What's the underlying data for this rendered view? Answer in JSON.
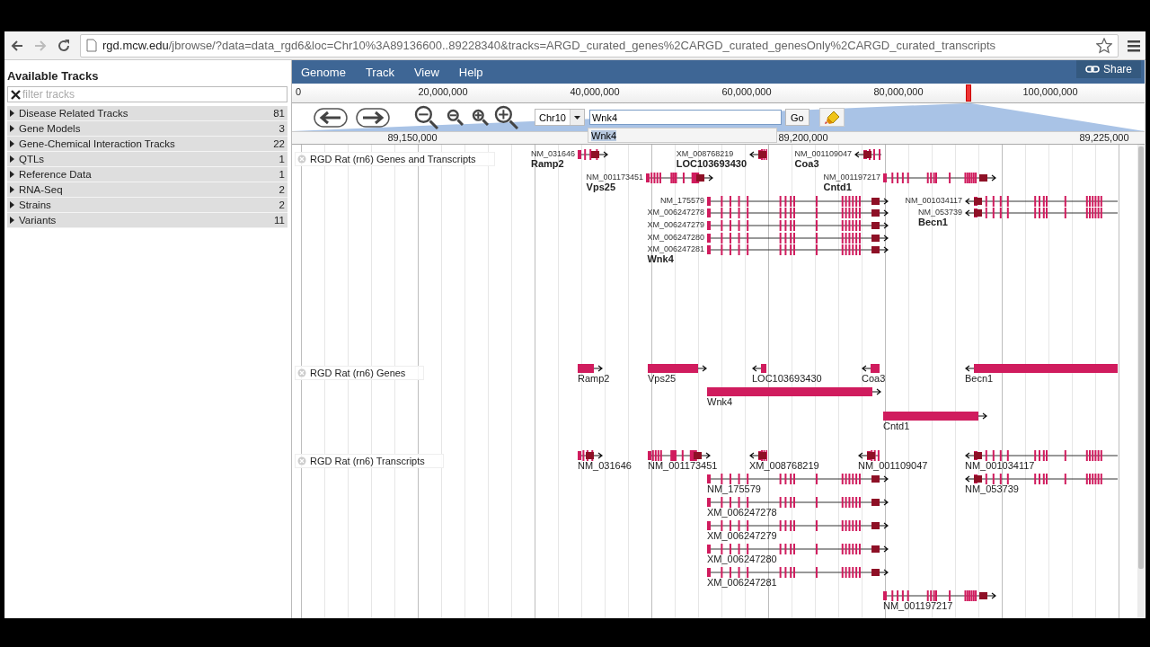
{
  "browser": {
    "url_host": "rgd.mcw.edu",
    "url_path": "/jbrowse/?data=data_rgd6&loc=Chr10%3A89136600..89228340&tracks=ARGD_curated_genes%2CARGD_curated_genesOnly%2CARGD_curated_transcripts"
  },
  "sidebar": {
    "title": "Available Tracks",
    "filter": {
      "placeholder": "filter tracks"
    },
    "categories": [
      {
        "label": "Disease Related Tracks",
        "count": "81",
        "expanded": false
      },
      {
        "label": "Gene Models",
        "count": "3",
        "expanded": false
      },
      {
        "label": "Gene-Chemical Interaction Tracks",
        "count": "22",
        "expanded": false
      },
      {
        "label": "QTLs",
        "count": "1",
        "expanded": false
      },
      {
        "label": "Reference Data",
        "count": "1",
        "expanded": false
      },
      {
        "label": "RNA-Seq",
        "count": "2",
        "expanded": false
      },
      {
        "label": "Strains",
        "count": "2",
        "expanded": false
      },
      {
        "label": "Variants",
        "count": "11",
        "expanded": false
      }
    ]
  },
  "menubar": {
    "items": [
      "Genome",
      "Track",
      "View",
      "Help"
    ],
    "share": "Share"
  },
  "overview": {
    "ticks": [
      "0",
      "20,000,000",
      "40,000,000",
      "60,000,000",
      "80,000,000",
      "100,000,000"
    ]
  },
  "navigation": {
    "chromosome": "Chr10",
    "search": {
      "value": "Wnk4"
    },
    "go": "Go",
    "suggestions": [
      {
        "label": "Wnk4",
        "selected": true
      }
    ]
  },
  "ruler": {
    "ticks": [
      "89,150,000",
      "89,200,000",
      "89,225,000"
    ]
  },
  "tracks": [
    {
      "label": "RGD Rat (rn6) Genes and Transcripts",
      "kind": "named_transcripts",
      "features": [
        {
          "label": "NM_031646",
          "name": "Ramp2",
          "forward_strand": true
        },
        {
          "label": "XM_008768219",
          "name": "LOC103693430",
          "forward_strand": false
        },
        {
          "label": "NM_001109047",
          "name": "Coa3",
          "forward_strand": false
        },
        {
          "label": "NM_001173451",
          "name": "Vps25",
          "forward_strand": true
        },
        {
          "label": "NM_001197217",
          "name": "Cntd1",
          "forward_strand": true
        },
        {
          "label": "NM_175579",
          "forward_strand": true
        },
        {
          "label": "XM_006247278",
          "forward_strand": true
        },
        {
          "label": "XM_006247279",
          "forward_strand": true
        },
        {
          "label": "XM_006247280",
          "forward_strand": true
        },
        {
          "label": "XM_006247281",
          "name": "Wnk4",
          "forward_strand": true
        },
        {
          "label": "NM_001034117",
          "forward_strand": false
        },
        {
          "label": "NM_053739",
          "name": "Becn1",
          "forward_strand": false
        }
      ]
    },
    {
      "label": "RGD Rat (rn6) Genes",
      "kind": "genes",
      "features": [
        {
          "label": "Ramp2",
          "forward_strand": true
        },
        {
          "label": "Vps25",
          "forward_strand": true
        },
        {
          "label": "LOC103693430",
          "forward_strand": false
        },
        {
          "label": "Coa3",
          "forward_strand": false
        },
        {
          "label": "Becn1",
          "forward_strand": false
        },
        {
          "label": "Wnk4",
          "forward_strand": true
        },
        {
          "label": "Cntd1",
          "forward_strand": true
        }
      ]
    },
    {
      "label": "RGD Rat (rn6) Transcripts",
      "kind": "transcripts",
      "features": [
        {
          "label": "NM_031646",
          "forward_strand": true
        },
        {
          "label": "NM_001173451",
          "forward_strand": true
        },
        {
          "label": "XM_008768219",
          "forward_strand": false
        },
        {
          "label": "NM_001109047",
          "forward_strand": false
        },
        {
          "label": "NM_001034117",
          "forward_strand": false
        },
        {
          "label": "NM_175579",
          "forward_strand": true
        },
        {
          "label": "NM_053739",
          "forward_strand": false
        },
        {
          "label": "XM_006247278",
          "forward_strand": true
        },
        {
          "label": "XM_006247279",
          "forward_strand": true
        },
        {
          "label": "XM_006247280",
          "forward_strand": true
        },
        {
          "label": "XM_006247281",
          "forward_strand": true
        },
        {
          "label": "NM_001197217",
          "forward_strand": true
        }
      ]
    }
  ]
}
